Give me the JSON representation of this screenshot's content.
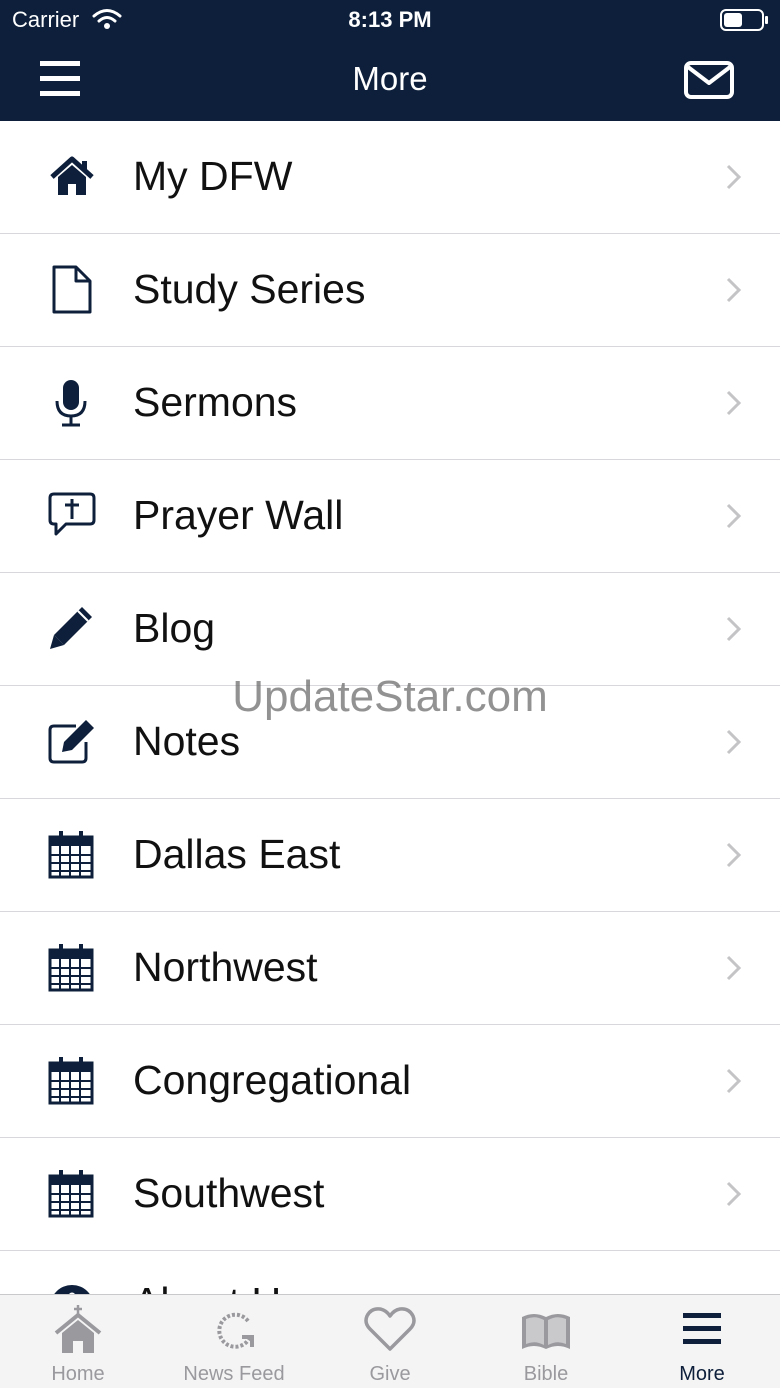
{
  "status_bar": {
    "carrier": "Carrier",
    "time": "8:13 PM"
  },
  "nav": {
    "title": "More"
  },
  "menu_items": [
    {
      "label": "My DFW",
      "icon": "home-icon"
    },
    {
      "label": "Study Series",
      "icon": "document-icon"
    },
    {
      "label": "Sermons",
      "icon": "microphone-icon"
    },
    {
      "label": "Prayer Wall",
      "icon": "prayer-chat-icon"
    },
    {
      "label": "Blog",
      "icon": "pencil-icon"
    },
    {
      "label": "Notes",
      "icon": "edit-note-icon"
    },
    {
      "label": "Dallas East",
      "icon": "calendar-icon"
    },
    {
      "label": "Northwest",
      "icon": "calendar-icon"
    },
    {
      "label": "Congregational",
      "icon": "calendar-icon"
    },
    {
      "label": "Southwest",
      "icon": "calendar-icon"
    },
    {
      "label": "About Us",
      "icon": "info-icon"
    }
  ],
  "watermark": "UpdateStar.com",
  "tabs": [
    {
      "label": "Home",
      "icon": "church-icon",
      "active": false
    },
    {
      "label": "News Feed",
      "icon": "refresh-icon",
      "active": false
    },
    {
      "label": "Give",
      "icon": "heart-icon",
      "active": false
    },
    {
      "label": "Bible",
      "icon": "book-icon",
      "active": false
    },
    {
      "label": "More",
      "icon": "menu-icon",
      "active": true
    }
  ],
  "colors": {
    "nav_bg": "#0d1f3a",
    "icon": "#0d1f3a",
    "tab_inactive": "#9a9a9e",
    "chevron": "#c4c4c7"
  }
}
